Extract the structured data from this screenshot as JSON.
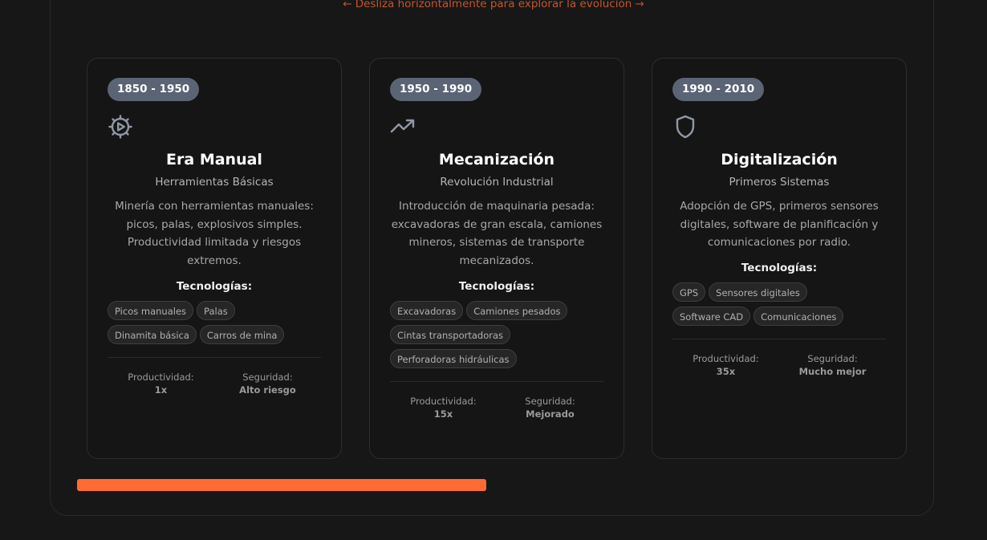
{
  "hint": "← Desliza horizontalmente para explorar la evolución →",
  "cards": [
    {
      "period": "1850 - 1950",
      "icon": "gear-icon",
      "title": "Era Manual",
      "subtitle": "Herramientas Básicas",
      "description": "Minería con herramientas manuales: picos, palas, explosivos simples. Productividad limitada y riesgos extremos.",
      "tech_heading": "Tecnologías:",
      "technologies": [
        "Picos manuales",
        "Palas",
        "Dinamita básica",
        "Carros de mina"
      ],
      "productivity_label": "Productividad:",
      "productivity_value": "1x",
      "safety_label": "Seguridad:",
      "safety_value": "Alto riesgo"
    },
    {
      "period": "1950 - 1990",
      "icon": "trending-up-icon",
      "title": "Mecanización",
      "subtitle": "Revolución Industrial",
      "description": "Introducción de maquinaria pesada: excavadoras de gran escala, camiones mineros, sistemas de transporte mecanizados.",
      "tech_heading": "Tecnologías:",
      "technologies": [
        "Excavadoras",
        "Camiones pesados",
        "Cintas transportadoras",
        "Perforadoras hidráulicas"
      ],
      "productivity_label": "Productividad:",
      "productivity_value": "15x",
      "safety_label": "Seguridad:",
      "safety_value": "Mejorado"
    },
    {
      "period": "1990 - 2010",
      "icon": "shield-icon",
      "title": "Digitalización",
      "subtitle": "Primeros Sistemas",
      "description": "Adopción de GPS, primeros sensores digitales, software de planificación y comunicaciones por radio.",
      "tech_heading": "Tecnologías:",
      "technologies": [
        "GPS",
        "Sensores digitales",
        "Software CAD",
        "Comunicaciones"
      ],
      "productivity_label": "Productividad:",
      "productivity_value": "35x",
      "safety_label": "Seguridad:",
      "safety_value": "Mucho mejor"
    }
  ],
  "scroll_progress": 0.47,
  "colors": {
    "accent": "#ff6b35",
    "badge": "#5b6474",
    "hint": "#c2552d"
  }
}
